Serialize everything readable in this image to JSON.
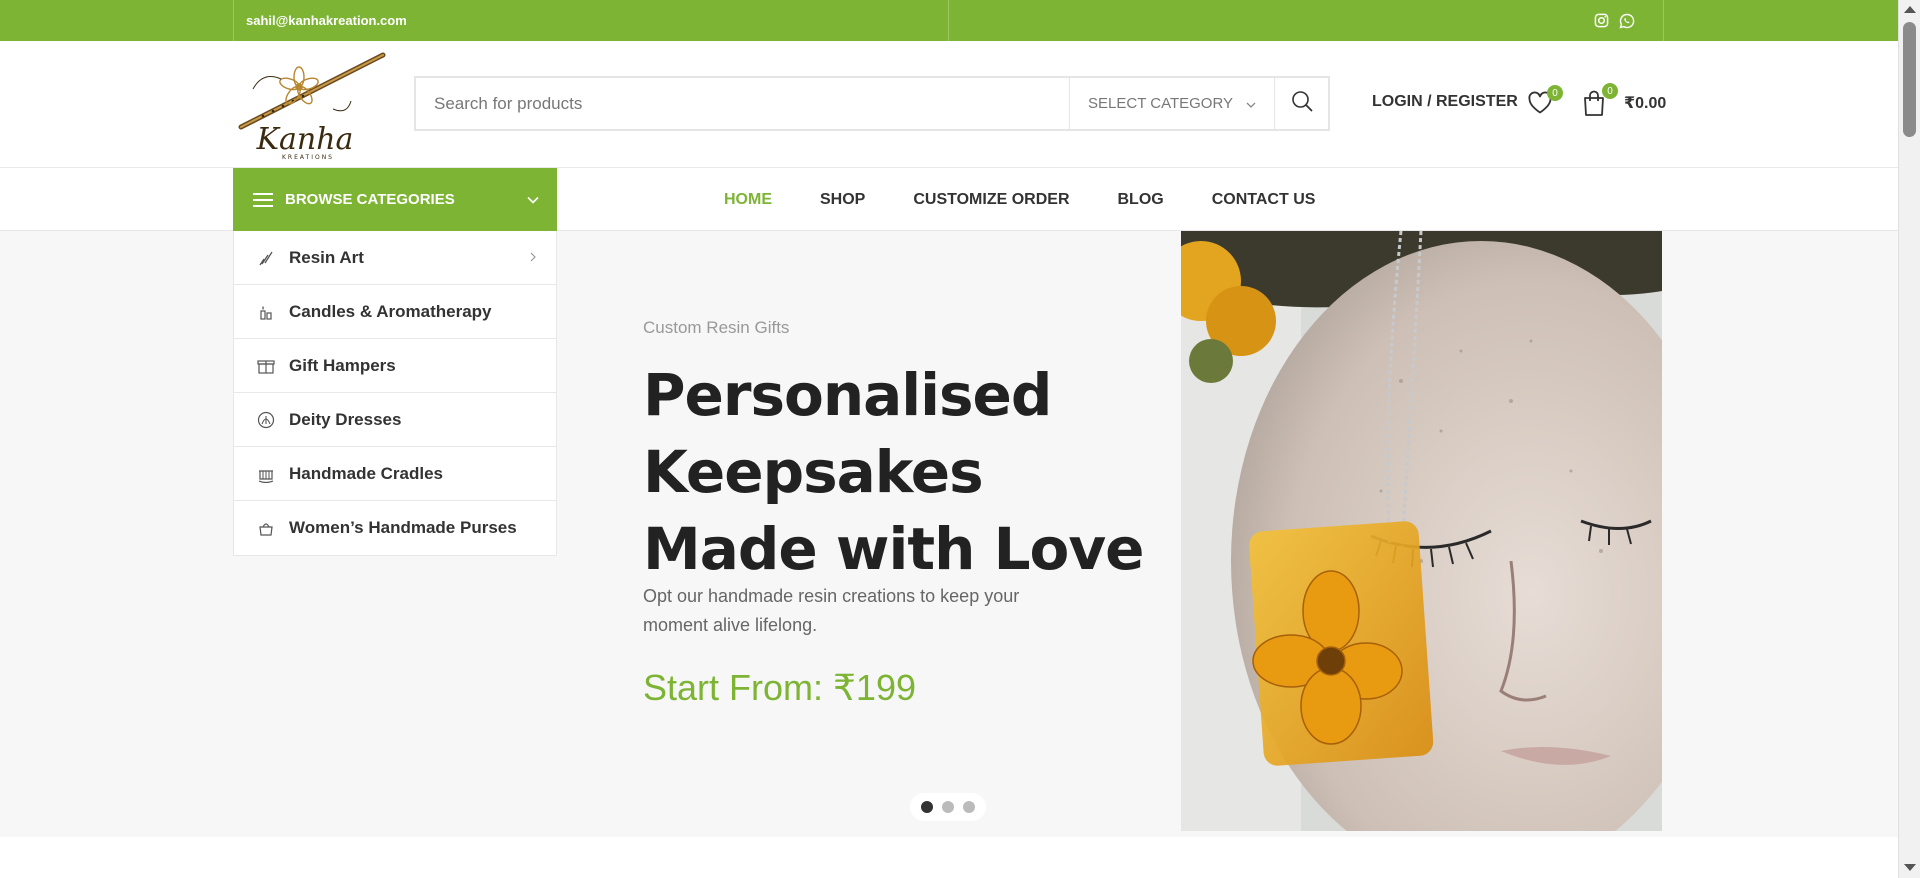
{
  "topbar": {
    "email": "sahil@kanhakreation.com",
    "social": [
      "instagram-icon",
      "whatsapp-icon"
    ]
  },
  "brand": {
    "logo_text": "Kanha",
    "logo_sub": "KREATIONS"
  },
  "search": {
    "placeholder": "Search for products",
    "category_label": "SELECT CATEGORY"
  },
  "account": {
    "login_label": "LOGIN / REGISTER",
    "wishlist_count": "0",
    "cart_count": "0",
    "cart_total": "₹0.00"
  },
  "browse": {
    "label": "BROWSE CATEGORIES"
  },
  "nav": {
    "items": [
      {
        "label": "HOME"
      },
      {
        "label": "SHOP"
      },
      {
        "label": "CUSTOMIZE ORDER"
      },
      {
        "label": "BLOG"
      },
      {
        "label": "CONTACT US"
      }
    ]
  },
  "categories": [
    {
      "label": "Resin Art",
      "icon": "brush-icon",
      "has_arrow": true
    },
    {
      "label": "Candles & Aromatherapy",
      "icon": "candle-icon"
    },
    {
      "label": "Gift Hampers",
      "icon": "gift-icon"
    },
    {
      "label": "Deity Dresses",
      "icon": "deity-icon"
    },
    {
      "label": "Handmade Cradles",
      "icon": "cradle-icon"
    },
    {
      "label": "Women’s Handmade Purses",
      "icon": "purse-icon"
    }
  ],
  "slide": {
    "subtitle": "Custom Resin Gifts",
    "title": "Personalised Keepsakes Made with Love",
    "description": "Opt our handmade resin creations to keep your moment alive lifelong.",
    "price": "Start  From:  ₹199",
    "dots": 3,
    "active_dot": 1
  },
  "colors": {
    "accent": "#7db434",
    "text": "#222222",
    "muted": "#999999"
  }
}
